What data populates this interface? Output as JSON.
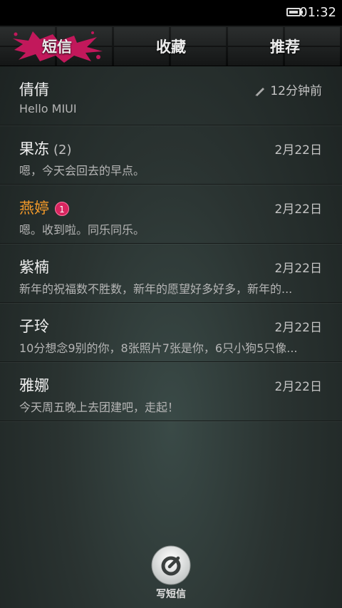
{
  "status_bar": {
    "time": "01:32",
    "battery_icon": "battery-icon"
  },
  "tabs": [
    {
      "label": "短信",
      "active": true
    },
    {
      "label": "收藏",
      "active": false
    },
    {
      "label": "推荐",
      "active": false
    }
  ],
  "colors": {
    "accent_splash": "#c2185b",
    "highlight_name": "#f39a2a",
    "badge": "#d8255f"
  },
  "conversations": [
    {
      "name": "倩倩",
      "count": "",
      "unread": "",
      "date": "12分钟前",
      "date_icon": "pencil-icon",
      "preview": "Hello MIUI"
    },
    {
      "name": "果冻",
      "count": "(2)",
      "unread": "",
      "date": "2月22日",
      "preview": "嗯，今天会回去的早点。"
    },
    {
      "name": "燕婷",
      "count": "",
      "unread": "1",
      "date": "2月22日",
      "preview": "嗯。收到啦。同乐同乐。"
    },
    {
      "name": "紫楠",
      "count": "",
      "unread": "",
      "date": "2月22日",
      "preview": "新年的祝福数不胜数，新年的愿望好多好多，新年的..."
    },
    {
      "name": "子玲",
      "count": "",
      "unread": "",
      "date": "2月22日",
      "preview": "10分想念9别的你，8张照片7张是你，6只小狗5只像..."
    },
    {
      "name": "雅娜",
      "count": "",
      "unread": "",
      "date": "2月22日",
      "preview": "今天周五晚上去团建吧，走起！"
    }
  ],
  "compose": {
    "label": "写短信",
    "icon": "compose-icon"
  }
}
